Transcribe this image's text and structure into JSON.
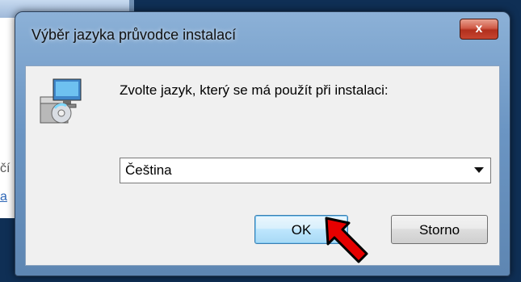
{
  "background": {
    "partial_text": "čí",
    "partial_link": "a"
  },
  "dialog": {
    "title": "Výběr jazyka průvodce instalací",
    "close_label": "x",
    "prompt": "Zvolte jazyk, který se má použít při instalaci:",
    "language_select": {
      "value": "Čeština",
      "icon": "chevron-down-icon"
    },
    "ok_label": "OK",
    "cancel_label": "Storno"
  },
  "annotation": {
    "pointer": "red-arrow-icon",
    "color": "#e60000"
  }
}
